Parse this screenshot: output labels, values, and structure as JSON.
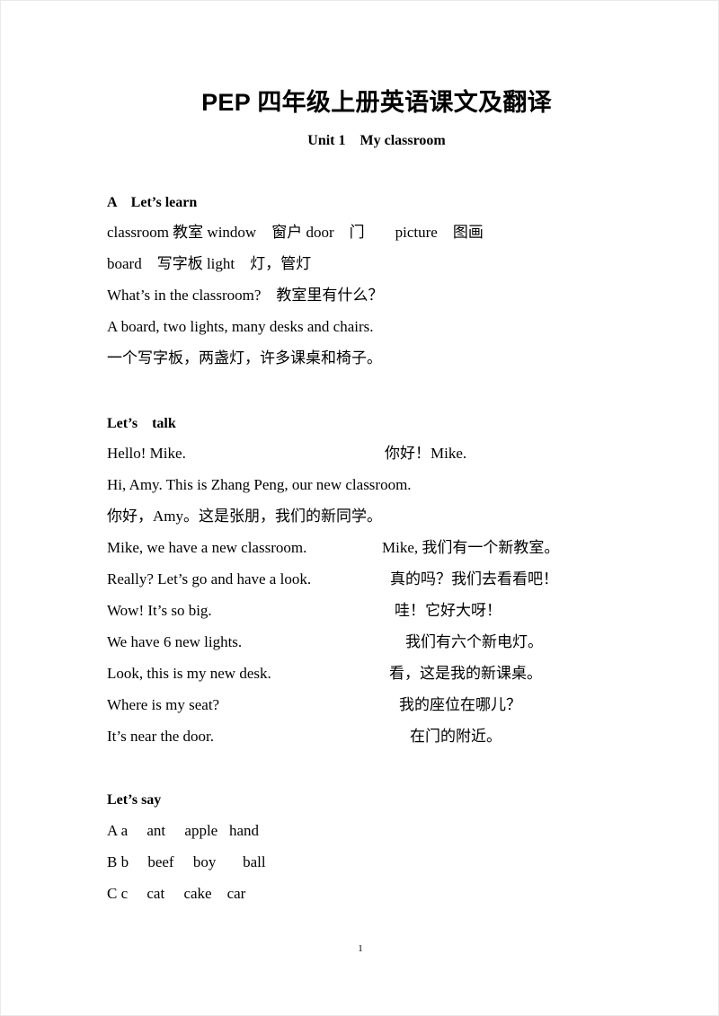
{
  "document": {
    "title": "PEP 四年级上册英语课文及翻译",
    "subtitle": "Unit 1    My classroom",
    "page_number": "1"
  },
  "sections": {
    "lets_learn": {
      "heading": "A    Let’s learn",
      "vocab_line_1": "classroom 教室 window    窗户 door    门        picture    图画",
      "vocab_line_2": "board    写字板 light    灯，管灯",
      "qa_en": "What’s in the classroom?    教室里有什么？",
      "answer_en": "A board, two lights, many desks and chairs.",
      "answer_cn": "一个写字板，两盏灯，许多课桌和椅子。"
    },
    "lets_talk": {
      "heading": "Let’s    talk",
      "lines": [
        {
          "en": "Hello! Mike.",
          "cn": "你好！Mike."
        },
        {
          "en": "Hi, Amy. This is Zhang Peng, our new classroom.",
          "cn": ""
        },
        {
          "en": "",
          "cn": "你好，Amy。这是张朋，我们的新同学。"
        },
        {
          "en": "Mike, we have a new classroom.",
          "cn": "Mike, 我们有一个新教室。"
        },
        {
          "en": "Really? Let’s go and have a look.",
          "cn": "真的吗？我们去看看吧！"
        },
        {
          "en": "Wow! It’s so big.",
          "cn": "哇！它好大呀！"
        },
        {
          "en": "We have 6 new lights.",
          "cn": "我们有六个新电灯。"
        },
        {
          "en": "Look, this is my new desk.",
          "cn": "看，这是我的新课桌。"
        },
        {
          "en": "Where is my seat?",
          "cn": "我的座位在哪儿？"
        },
        {
          "en": "It’s near the door.",
          "cn": "在门的附近。"
        }
      ]
    },
    "lets_say": {
      "heading": "Let’s say",
      "rows": [
        "A a     ant     apple   hand",
        "B b     beef     boy       ball",
        "C c     cat     cake    car"
      ]
    }
  }
}
